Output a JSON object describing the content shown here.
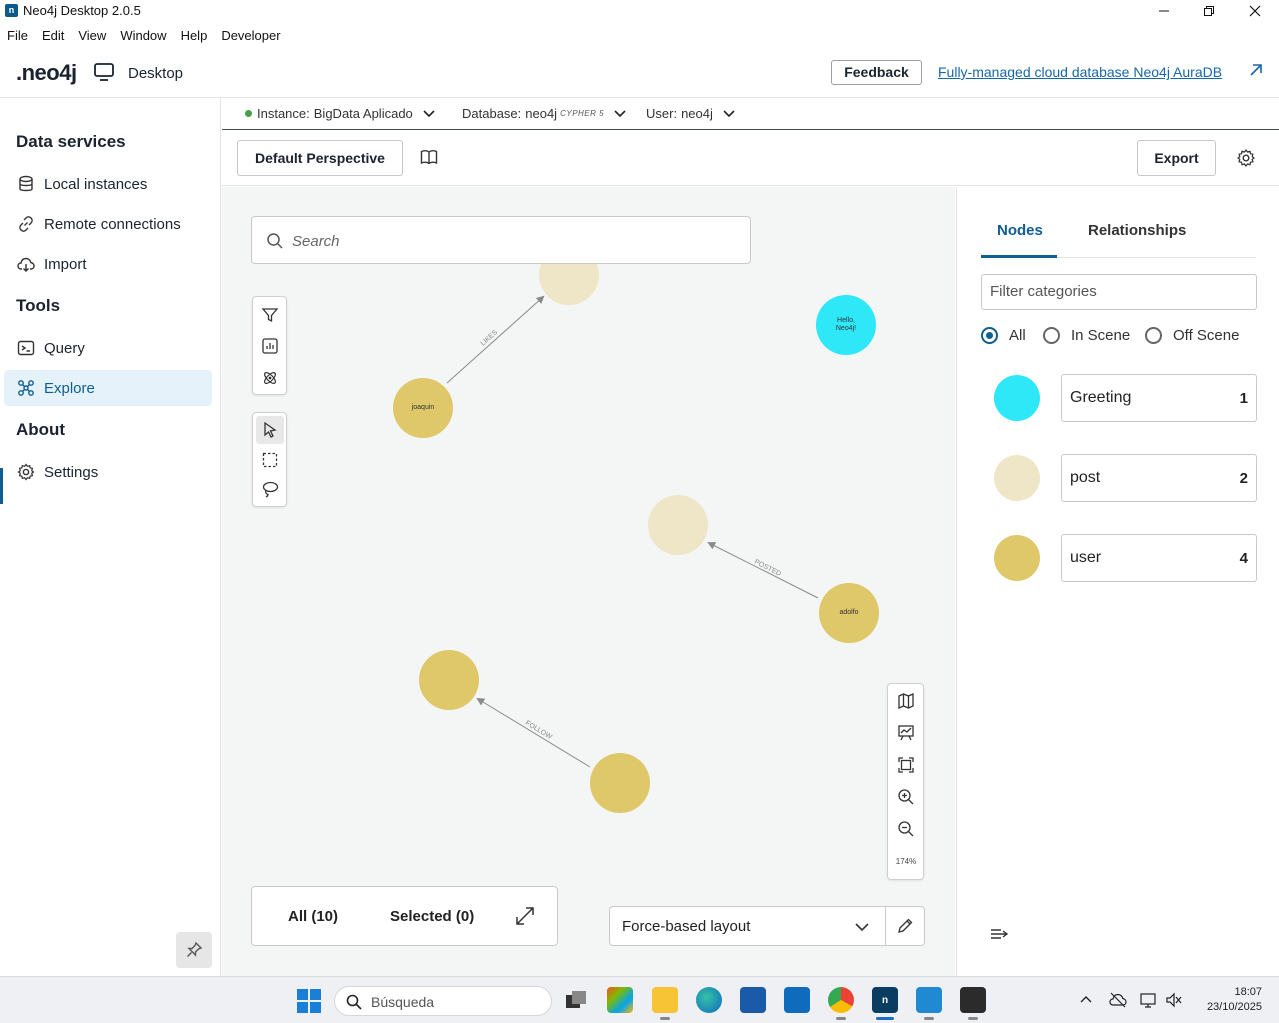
{
  "window": {
    "title": "Neo4j Desktop 2.0.5",
    "app_icon": "neo4j-icon"
  },
  "menu": [
    "File",
    "Edit",
    "View",
    "Window",
    "Help",
    "Developer"
  ],
  "header": {
    "logo": ".neo4j",
    "desktop_label": "Desktop",
    "feedback_label": "Feedback",
    "aura_link": "Fully-managed cloud database Neo4j AuraDB"
  },
  "sidebar": {
    "sections": [
      {
        "heading": "Data services"
      },
      {
        "heading": "Tools"
      },
      {
        "heading": "About"
      }
    ],
    "items": [
      {
        "label": "Local instances",
        "icon": "database-icon"
      },
      {
        "label": "Remote connections",
        "icon": "link-icon"
      },
      {
        "label": "Import",
        "icon": "cloud-upload-icon"
      },
      {
        "label": "Query",
        "icon": "terminal-icon"
      },
      {
        "label": "Explore",
        "icon": "graph-icon",
        "active": true
      },
      {
        "label": "Settings",
        "icon": "gear-icon"
      }
    ],
    "active_color": "#0f5d91"
  },
  "connection": {
    "instance_label": "Instance:",
    "instance_value": "BigData Aplicado",
    "instance_status_color": "#43a047",
    "database_label": "Database:",
    "database_value": "neo4j",
    "database_tag": "CYPHER 5",
    "user_label": "User:",
    "user_value": "neo4j"
  },
  "toolbar": {
    "perspective_label": "Default Perspective",
    "export_label": "Export"
  },
  "canvas": {
    "search_placeholder": "Search",
    "zoom_level": "174%",
    "nodes": [
      {
        "id": "post-top",
        "label": "",
        "category": "post"
      },
      {
        "id": "greeting",
        "label": "Hello, Neo4j!",
        "category": "Greeting"
      },
      {
        "id": "joaquin",
        "label": "joaquin",
        "category": "user"
      },
      {
        "id": "post-mid",
        "label": "",
        "category": "post"
      },
      {
        "id": "adolfo",
        "label": "adolfo",
        "category": "user"
      },
      {
        "id": "user-a",
        "label": "",
        "category": "user"
      },
      {
        "id": "user-b",
        "label": "",
        "category": "user"
      }
    ],
    "relationships": [
      {
        "type": "LIKES",
        "from": "joaquin",
        "to": "post-top"
      },
      {
        "type": "POSTED",
        "from": "adolfo",
        "to": "post-mid"
      },
      {
        "type": "FOLLOW",
        "from": "user-b",
        "to": "user-a"
      }
    ],
    "scene": {
      "all_label": "All (10)",
      "selected_label": "Selected (0)"
    },
    "layout": {
      "selected": "Force-based layout"
    }
  },
  "right_panel": {
    "tabs": [
      "Nodes",
      "Relationships"
    ],
    "active_tab": "Nodes",
    "filter_placeholder": "Filter categories",
    "radios": [
      {
        "label": "All",
        "checked": true
      },
      {
        "label": "In Scene",
        "checked": false
      },
      {
        "label": "Off Scene",
        "checked": false
      }
    ],
    "categories": [
      {
        "name": "Greeting",
        "count": "1",
        "color": "#2ee8f8"
      },
      {
        "name": "post",
        "count": "2",
        "color": "#efe6c8"
      },
      {
        "name": "user",
        "count": "4",
        "color": "#dfc86a"
      }
    ]
  },
  "taskbar": {
    "search_label": "Búsqueda",
    "time": "18:07",
    "date": "23/10/2025"
  }
}
